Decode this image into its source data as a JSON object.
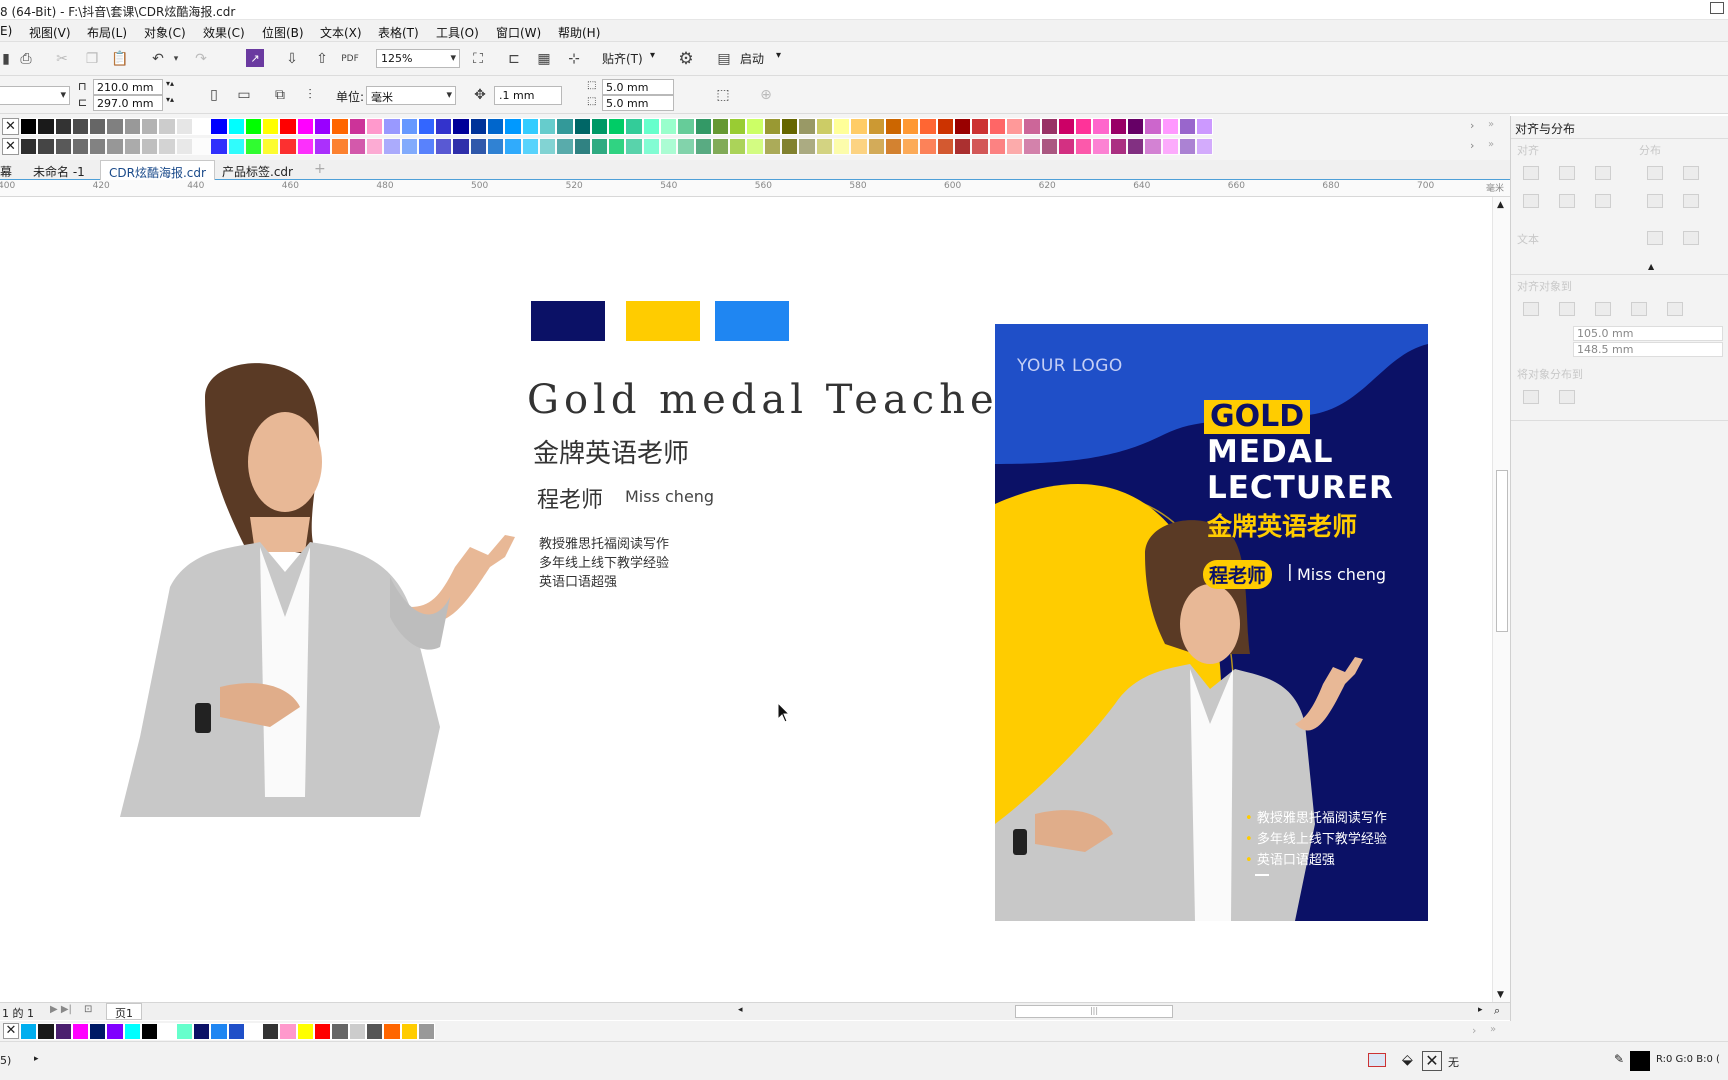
{
  "titlebar": {
    "title": "8 (64-Bit) - F:\\抖音\\套课\\CDR炫酷海报.cdr"
  },
  "menu": [
    {
      "label": "E)"
    },
    {
      "label": "视图(V)"
    },
    {
      "label": "布局(L)"
    },
    {
      "label": "对象(C)"
    },
    {
      "label": "效果(C)"
    },
    {
      "label": "位图(B)"
    },
    {
      "label": "文本(X)"
    },
    {
      "label": "表格(T)"
    },
    {
      "label": "工具(O)"
    },
    {
      "label": "窗口(W)"
    },
    {
      "label": "帮助(H)"
    }
  ],
  "toolbar": {
    "zoom": "125%",
    "snap_label": "贴齐(T)",
    "launch_label": "启动"
  },
  "propbar": {
    "width": "210.0 mm",
    "height": "297.0 mm",
    "unit_label": "单位:",
    "unit_value": "毫米",
    "nudge": ".1 mm",
    "dup_x": "5.0 mm",
    "dup_y": "5.0 mm"
  },
  "tabs": [
    {
      "label": "幕"
    },
    {
      "label": "未命名 -1"
    },
    {
      "label": "CDR炫酷海报.cdr"
    },
    {
      "label": "产品标签.cdr"
    }
  ],
  "ruler": {
    "ticks": [
      "400",
      "420",
      "440",
      "460",
      "480",
      "500",
      "520",
      "540",
      "560",
      "580",
      "600",
      "620",
      "640",
      "660",
      "680",
      "700"
    ],
    "unit": "毫米"
  },
  "swatch_colors": [
    "#0b1166",
    "#ffcc00",
    "#1f86f2"
  ],
  "design_left": {
    "heading_en": "Gold medal Teacher",
    "heading_cn": "金牌英语老师",
    "name_cn": "程老师",
    "name_en": "Miss cheng",
    "lines": [
      "教授雅思托福阅读写作",
      "多年线上线下教学经验",
      "英语口语超强"
    ]
  },
  "poster": {
    "logo": "YOUR LOGO",
    "gold": "GOLD",
    "medal": "MEDAL",
    "lecturer": "LECTURER",
    "cn_title": "金牌英语老师",
    "name_cn": "程老师",
    "name_sep": "|",
    "name_en": "Miss cheng",
    "bullets": [
      "教授雅思托福阅读写作",
      "多年线上线下教学经验",
      "英语口语超强"
    ]
  },
  "right_panel": {
    "title": "对齐与分布",
    "align": "对齐",
    "distribute": "分布",
    "text": "文本",
    "align_to": "对齐对象到",
    "size_w": "105.0 mm",
    "size_h": "148.5 mm",
    "dist_to": "将对象分布到"
  },
  "pagebar": {
    "page_count": "1 的 1",
    "page_tab": "页1"
  },
  "statusbar": {
    "left": "5)",
    "fill_none": "无",
    "color_readout": "R:0 G:0 B:0 ("
  },
  "colors": {
    "accent": "#4ea0d8",
    "poster_blue": "#0b1166",
    "poster_yellow": "#ffcc00"
  }
}
